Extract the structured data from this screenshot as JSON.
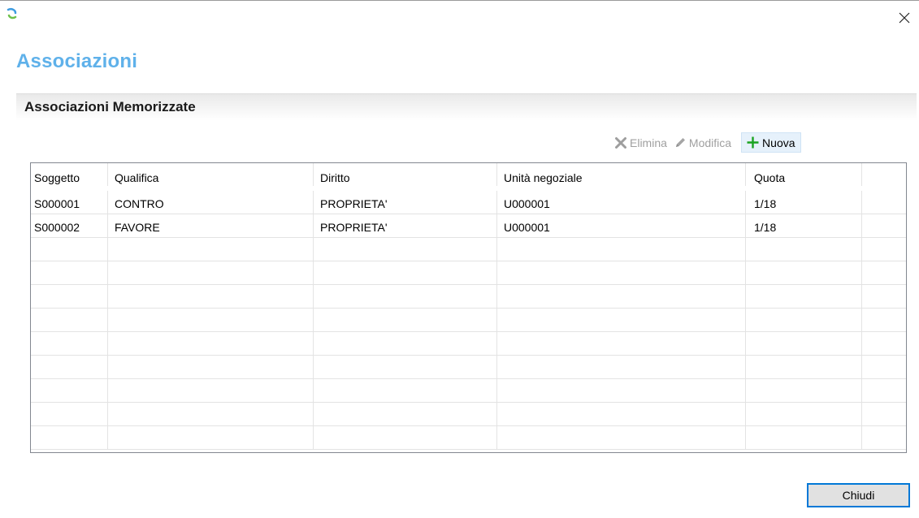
{
  "window": {
    "app_icon": "app-logo-icon",
    "close_icon": "close-icon"
  },
  "page": {
    "title": "Associazioni"
  },
  "section": {
    "title": "Associazioni Memorizzate"
  },
  "toolbar": {
    "delete_label": "Elimina",
    "delete_icon": "x-icon",
    "edit_label": "Modifica",
    "edit_icon": "pencil-icon",
    "new_label": "Nuova",
    "new_icon": "plus-icon"
  },
  "table": {
    "columns": [
      "Soggetto",
      "Qualifica",
      "Diritto",
      "Unità negoziale",
      "Quota",
      ""
    ],
    "rows": [
      [
        "S000001",
        "CONTRO",
        "PROPRIETA'",
        "U000001",
        "1/18",
        ""
      ],
      [
        "S000002",
        "FAVORE",
        "PROPRIETA'",
        "U000001",
        "1/18",
        ""
      ],
      [
        "",
        "",
        "",
        "",
        "",
        ""
      ],
      [
        "",
        "",
        "",
        "",
        "",
        ""
      ],
      [
        "",
        "",
        "",
        "",
        "",
        ""
      ],
      [
        "",
        "",
        "",
        "",
        "",
        ""
      ],
      [
        "",
        "",
        "",
        "",
        "",
        ""
      ],
      [
        "",
        "",
        "",
        "",
        "",
        ""
      ],
      [
        "",
        "",
        "",
        "",
        "",
        ""
      ],
      [
        "",
        "",
        "",
        "",
        "",
        ""
      ],
      [
        "",
        "",
        "",
        "",
        "",
        ""
      ]
    ]
  },
  "footer": {
    "close_label": "Chiudi"
  },
  "colors": {
    "title_blue": "#5fb1ea",
    "add_green": "#1aa320",
    "disabled_gray": "#a0a0a0",
    "focus_blue": "#0078d7"
  }
}
